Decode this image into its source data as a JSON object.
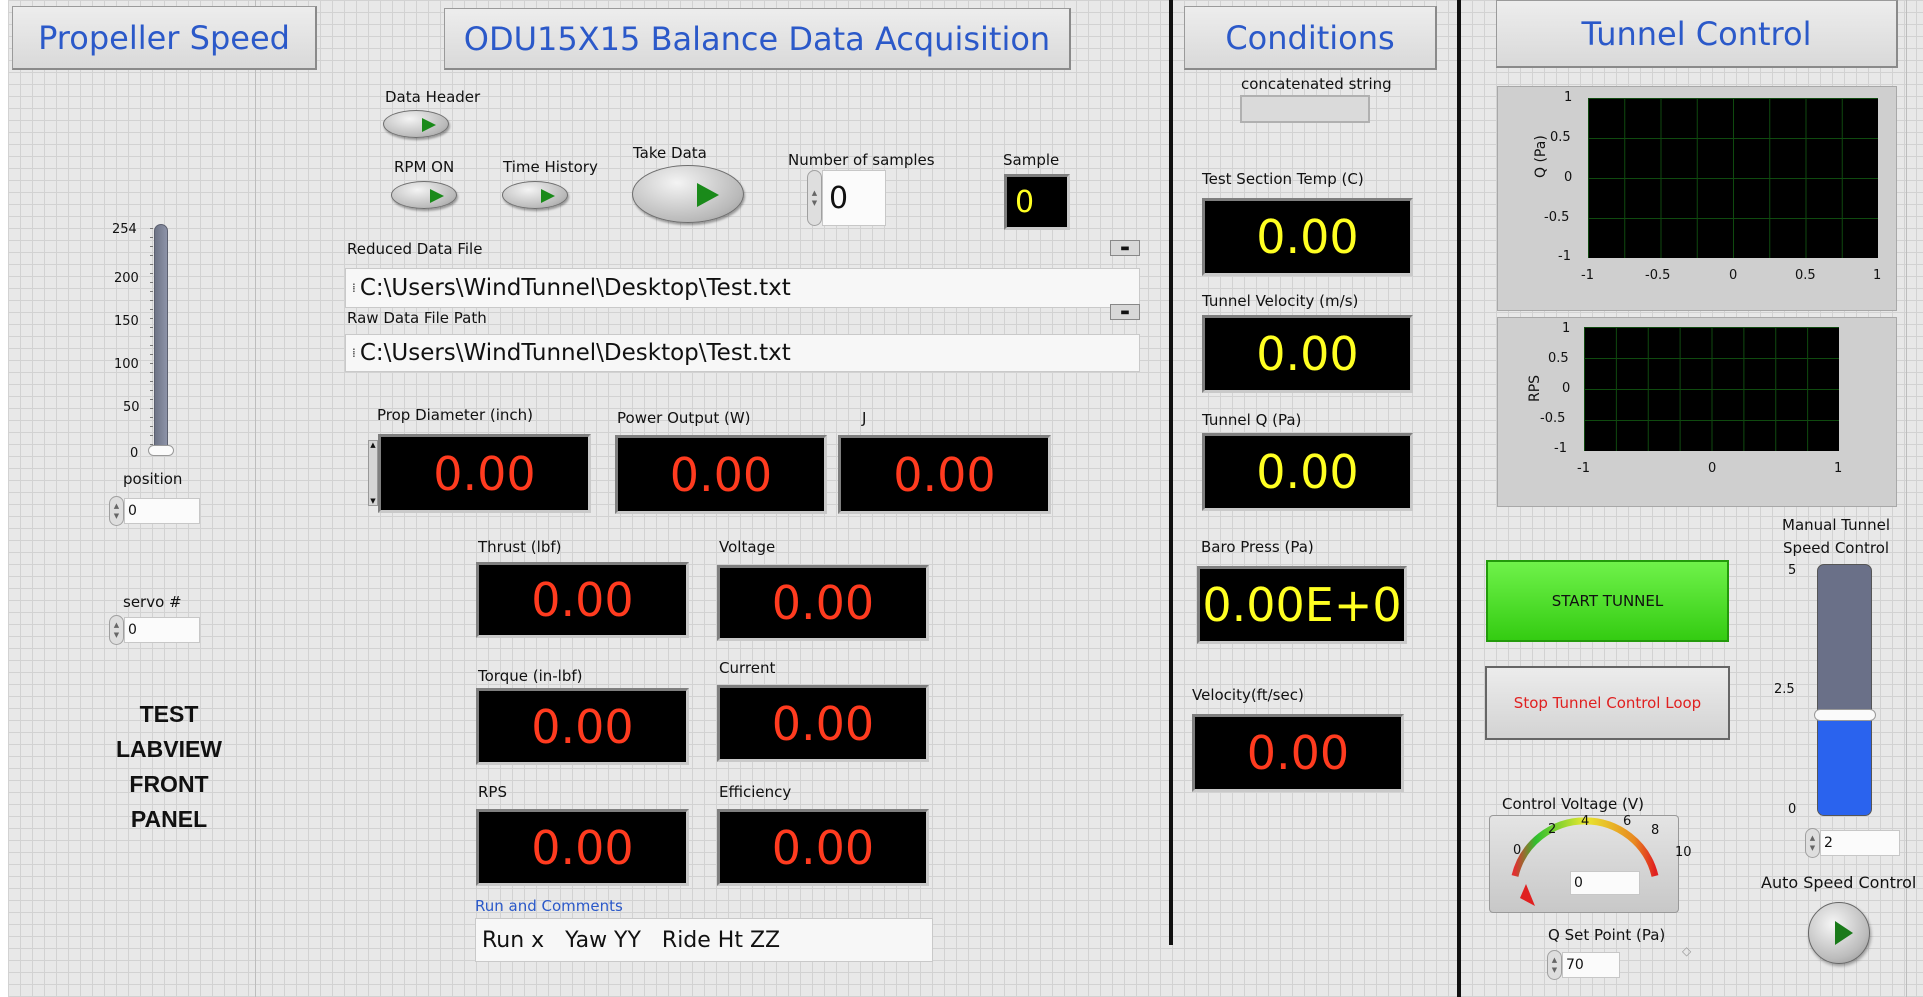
{
  "headers": {
    "propeller_speed": "Propeller Speed",
    "title": "ODU15X15 Balance Data Acquisition",
    "conditions": "Conditions",
    "tunnel_control": "Tunnel Control"
  },
  "left": {
    "slider_ticks": [
      "254",
      "200",
      "150",
      "100",
      "50",
      "0"
    ],
    "slider_value": 0,
    "slider_max": 254,
    "position_label": "position",
    "position_value": "0",
    "servo_label": "servo #",
    "servo_value": "0",
    "panel_caption_line1": "TEST LABVIEW",
    "panel_caption_line2": "FRONT PANEL"
  },
  "controls": {
    "data_header": "Data Header",
    "rpm_on": "RPM ON",
    "time_history": "Time History",
    "take_data": "Take Data",
    "num_samples_label": "Number of samples",
    "num_samples_value": "0",
    "sample_label": "Sample",
    "sample_value": "0"
  },
  "files": {
    "reduced_label": "Reduced Data File",
    "reduced_path": "C:\\Users\\WindTunnel\\Desktop\\Test.txt",
    "raw_label": "Raw Data File  Path",
    "raw_path": "C:\\Users\\WindTunnel\\Desktop\\Test.txt"
  },
  "indicators": {
    "prop_diameter": {
      "label": "Prop Diameter (inch)",
      "value": "0.00"
    },
    "power_output": {
      "label": "Power Output (W)",
      "value": "0.00"
    },
    "j": {
      "label": "J",
      "value": "0.00"
    },
    "thrust": {
      "label": "Thrust (lbf)",
      "value": "0.00"
    },
    "voltage": {
      "label": "Voltage",
      "value": "0.00"
    },
    "torque": {
      "label": "Torque (in-lbf)",
      "value": "0.00"
    },
    "current": {
      "label": "Current",
      "value": "0.00"
    },
    "rps": {
      "label": "RPS",
      "value": "0.00"
    },
    "efficiency": {
      "label": "Efficiency",
      "value": "0.00"
    }
  },
  "comments": {
    "label": "Run and Comments",
    "value": "Run x   Yaw YY   Ride Ht ZZ"
  },
  "conditions": {
    "concat_label": "concatenated string",
    "concat_value": "",
    "test_temp": {
      "label": "Test Section Temp (C)",
      "value": "0.00"
    },
    "tunnel_velocity": {
      "label": "Tunnel Velocity  (m/s)",
      "value": "0.00"
    },
    "tunnel_q": {
      "label": "Tunnel Q (Pa)",
      "value": "0.00"
    },
    "baro_press": {
      "label": "Baro Press (Pa)",
      "value": "0.00E+0"
    },
    "velocity_fts": {
      "label": "Velocity(ft/sec)",
      "value": "0.00"
    }
  },
  "tunnel": {
    "graph1": {
      "ylabel": "Q (Pa)",
      "yticks": [
        "1",
        "0.5",
        "0",
        "-0.5",
        "-1"
      ],
      "xticks": [
        "-1",
        "-0.5",
        "0",
        "0.5",
        "1"
      ]
    },
    "graph2": {
      "ylabel": "RPS",
      "yticks": [
        "1",
        "0.5",
        "0",
        "-0.5",
        "-1"
      ],
      "xticks": [
        "-1",
        "0",
        "1"
      ]
    },
    "start_button": "START TUNNEL",
    "stop_button": "Stop Tunnel Control Loop",
    "manual_label_1": "Manual Tunnel",
    "manual_label_2": "Speed Control",
    "manual_ticks": [
      "5",
      "2.5",
      "0"
    ],
    "manual_fill_fraction": 0.4,
    "manual_value": "2",
    "gauge_label": "Control Voltage (V)",
    "gauge_ticks": [
      "0",
      "2",
      "4",
      "6",
      "8",
      "10"
    ],
    "gauge_value": "0",
    "auto_speed_label": "Auto Speed Control",
    "q_set_label": "Q Set Point (Pa)",
    "q_set_value": "70"
  },
  "colors": {
    "header_text": "#2b59c9",
    "red_digits": "#ff3b1f",
    "yellow_digits": "#ffff22",
    "start_green": "#45e020",
    "stop_red_text": "#e02020",
    "slider_blue": "#2a63ee"
  }
}
